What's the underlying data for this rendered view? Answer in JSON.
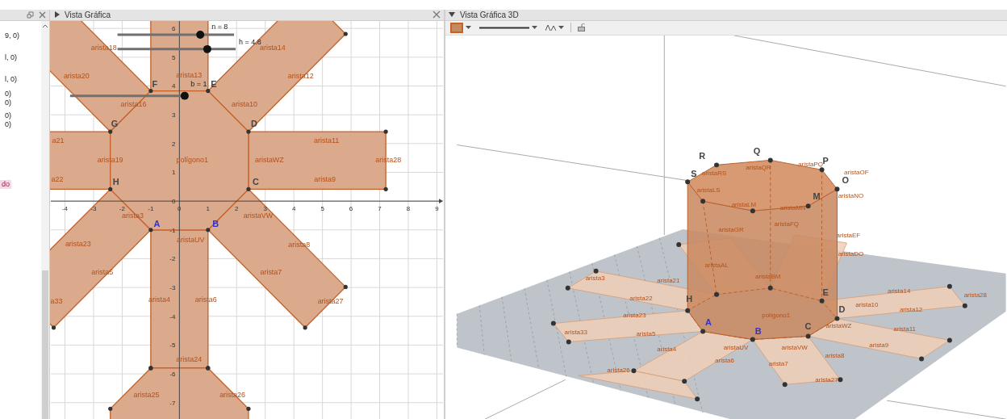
{
  "algebra_view": {
    "items": [
      {
        "text": "9, 0)",
        "selected": false
      },
      {
        "text": "l, 0)",
        "selected": false
      },
      {
        "text": "l, 0)",
        "selected": false
      },
      {
        "text": "0)",
        "selected": false
      },
      {
        "text": "0)",
        "selected": false
      },
      {
        "text": "0)",
        "selected": false
      },
      {
        "text": "0)",
        "selected": false
      },
      {
        "text": "do",
        "selected": true
      }
    ]
  },
  "graphics_view": {
    "title": "Vista Gráfica",
    "sliders": [
      {
        "label": "n = 8",
        "level": 0.71
      },
      {
        "label": "h = 4.8",
        "level": 0.76
      },
      {
        "label": "b = 1",
        "level": 0.99
      }
    ],
    "x_axis_labels": [
      "-4",
      "-3",
      "-2",
      "-1",
      "0",
      "1",
      "2",
      "3",
      "4",
      "5",
      "6",
      "7",
      "8",
      "9"
    ],
    "y_axis_labels": [
      "6",
      "5",
      "4",
      "3",
      "2",
      "1",
      "0",
      "-1",
      "-2",
      "-3",
      "-4",
      "-5",
      "-6",
      "-7"
    ],
    "labels": [
      "arista18",
      "arista14",
      "arista20",
      "arista13",
      "arista12",
      "arista16",
      "arista10",
      "a21",
      "arista11",
      "arista19",
      "polígono1",
      "aristaWZ",
      "arista28",
      "a22",
      "arista9",
      "arista3",
      "aristaVW",
      "aristaUV",
      "arista23",
      "arista8",
      "arista5",
      "arista7",
      "a33",
      "arista4",
      "arista6",
      "arista27",
      "arista24",
      "arista25",
      "arista26"
    ],
    "point_labels": [
      {
        "text": "F",
        "color": "#444444"
      },
      {
        "text": "E",
        "color": "#444444"
      },
      {
        "text": "G",
        "color": "#444444"
      },
      {
        "text": "D",
        "color": "#444444"
      },
      {
        "text": "H",
        "color": "#444444"
      },
      {
        "text": "C",
        "color": "#444444"
      },
      {
        "text": "A",
        "color": "#3333cc"
      },
      {
        "text": "B",
        "color": "#3333cc"
      }
    ]
  },
  "graphics_3d_view": {
    "title": "Vista Gráfica 3D",
    "point_labels": [
      {
        "text": "R",
        "color": "#444444"
      },
      {
        "text": "Q",
        "color": "#444444"
      },
      {
        "text": "P",
        "color": "#444444"
      },
      {
        "text": "O",
        "color": "#444444"
      },
      {
        "text": "S",
        "color": "#444444"
      },
      {
        "text": "M",
        "color": "#444444"
      },
      {
        "text": "H",
        "color": "#444444"
      },
      {
        "text": "A",
        "color": "#3333cc"
      },
      {
        "text": "B",
        "color": "#3333cc"
      },
      {
        "text": "C",
        "color": "#444444"
      },
      {
        "text": "D",
        "color": "#444444"
      },
      {
        "text": "E",
        "color": "#444444"
      }
    ],
    "labels": [
      "aristaQR",
      "aristaPQ",
      "aristaRS",
      "aristaOF",
      "aristaLS",
      "aristaNO",
      "aristaLM",
      "aristaMN",
      "aristaFQ",
      "aristaGR",
      "aristaEF",
      "aristaDO",
      "aristaAL",
      "aristaBM",
      "arista3",
      "arista21",
      "arista14",
      "arista28",
      "arista22",
      "arista10",
      "arista12",
      "arista23",
      "polígono1",
      "aristaWZ",
      "arista11",
      "arista33",
      "arista5",
      "aristaUV",
      "aristaVW",
      "arista9",
      "arista4",
      "arista8",
      "arista6",
      "arista7",
      "arista26",
      "arista27"
    ]
  }
}
